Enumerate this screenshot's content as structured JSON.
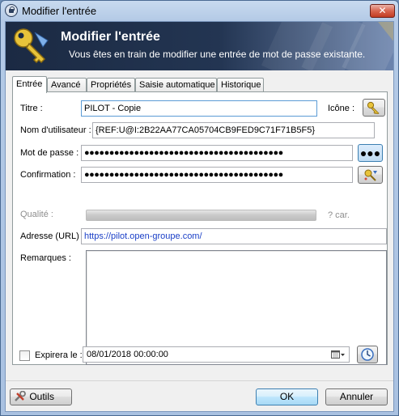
{
  "window": {
    "title": "Modifier l'entrée",
    "close_glyph": "✕",
    "app_icon": "keepass-lock-icon"
  },
  "banner": {
    "title": "Modifier l'entrée",
    "subtitle": "Vous êtes en train de modifier une entrée de mot de passe existante.",
    "icon": "key-icon"
  },
  "tabs": [
    {
      "label": "Entrée",
      "active": true
    },
    {
      "label": "Avancé",
      "active": false
    },
    {
      "label": "Propriétés",
      "active": false
    },
    {
      "label": "Saisie automatique",
      "active": false
    },
    {
      "label": "Historique",
      "active": false
    }
  ],
  "form": {
    "title_label": "Titre :",
    "title_value": "PILOT - Copie",
    "icon_label": "Icône :",
    "username_label": "Nom d'utilisateur :",
    "username_value": "{REF:U@I:2B22AA77CA05704CB9FED9C71F71B5F5}",
    "password_label": "Mot de passe :",
    "password_value": "●●●●●●●●●●●●●●●●●●●●●●●●●●●●●●●●●●●●●●●●",
    "show_password_glyph": "●●●",
    "confirm_label": "Confirmation :",
    "confirm_value": "●●●●●●●●●●●●●●●●●●●●●●●●●●●●●●●●●●●●●●●●",
    "quality_label": "Qualité :",
    "quality_chars": "? car.",
    "url_label": "Adresse (URL) :",
    "url_value": "https://pilot.open-groupe.com/",
    "notes_label": "Remarques :",
    "notes_value": "",
    "expires_label": "Expirera le :",
    "expires_checked": false,
    "expires_value": "08/01/2018 00:00:00"
  },
  "footer": {
    "tools_label": "Outils",
    "ok_label": "OK",
    "cancel_label": "Annuler"
  },
  "colors": {
    "banner_dark": "#1b2a43",
    "link": "#1a3fc7",
    "focus_border": "#5b9bd5"
  }
}
